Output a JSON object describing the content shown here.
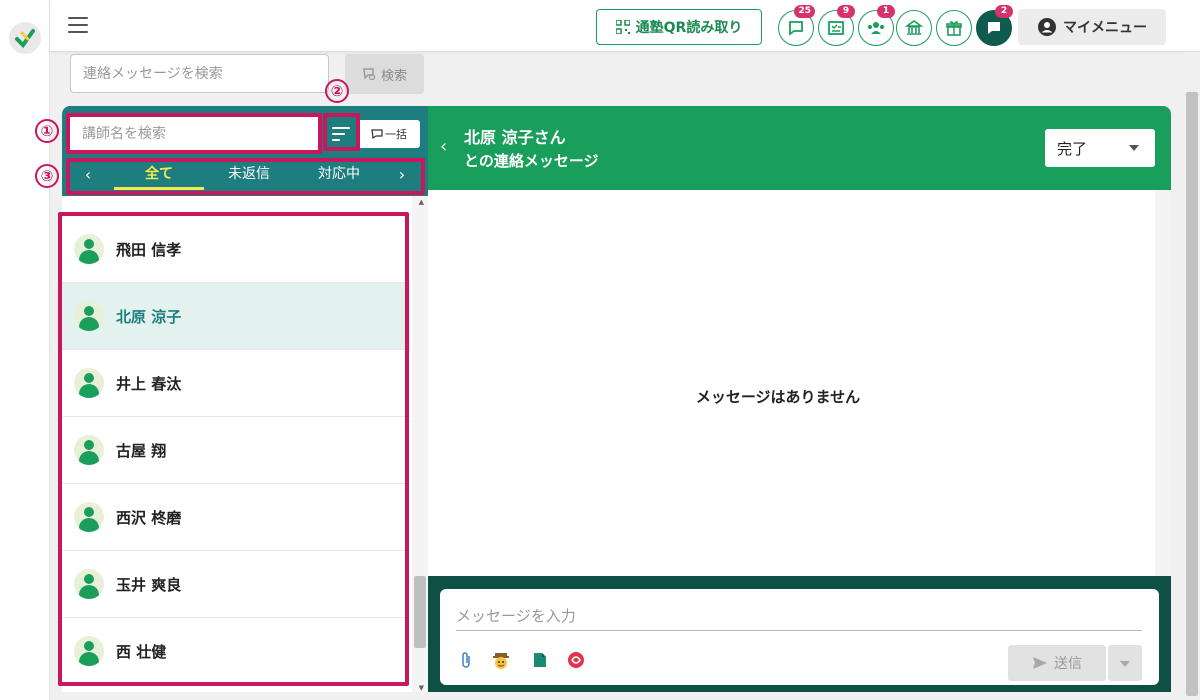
{
  "header": {
    "qr_button_label": "通塾QR読み取り",
    "badges": {
      "messages": "25",
      "tasks": "9",
      "group": "1",
      "chat": "2"
    },
    "mymenu_label": "マイメニュー"
  },
  "top_search": {
    "placeholder": "連絡メッセージを検索",
    "button_label": "検索"
  },
  "left_panel": {
    "teacher_search_placeholder": "講師名を検索",
    "bulk_label": "一括",
    "tabs": [
      {
        "label": "全て"
      },
      {
        "label": "未返信"
      },
      {
        "label": "対応中"
      }
    ],
    "teachers": [
      {
        "name": "飛田 信孝"
      },
      {
        "name": "北原 涼子"
      },
      {
        "name": "井上 春汰"
      },
      {
        "name": "古屋 翔"
      },
      {
        "name": "西沢 柊磨"
      },
      {
        "name": "玉井 爽良"
      },
      {
        "name": "西 壮健"
      }
    ]
  },
  "right_panel": {
    "title_line1": "北原 涼子さん",
    "title_line2": "との連絡メッセージ",
    "status_value": "完了",
    "empty_message": "メッセージはありません",
    "compose_placeholder": "メッセージを入力",
    "send_label": "送信"
  },
  "annotations": {
    "n1": "①",
    "n2": "②",
    "n3": "③"
  },
  "colors": {
    "brand_green": "#1a9e5c",
    "teal_header": "#1d7d7f",
    "dark_compose": "#0f5046",
    "annotation": "#c8175c",
    "active_tab": "#f2e94e"
  }
}
